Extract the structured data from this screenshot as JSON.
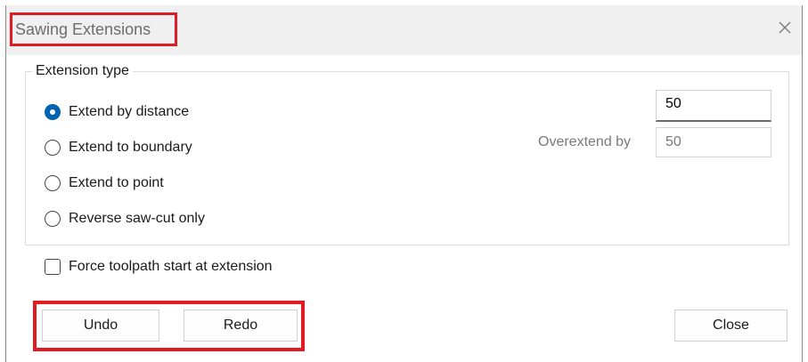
{
  "window": {
    "title": "Sawing Extensions"
  },
  "group": {
    "label": "Extension type",
    "options": [
      {
        "label": "Extend by distance",
        "checked": true
      },
      {
        "label": "Extend to boundary",
        "checked": false
      },
      {
        "label": "Extend to point",
        "checked": false
      },
      {
        "label": "Reverse saw-cut only",
        "checked": false
      }
    ],
    "distance_value": "50",
    "overextend_label": "Overextend by",
    "overextend_value": "50"
  },
  "checkbox": {
    "label": "Force toolpath start at extension",
    "checked": false
  },
  "buttons": {
    "undo": "Undo",
    "redo": "Redo",
    "close": "Close"
  },
  "colors": {
    "accent": "#0063b1",
    "highlight": "#e01b24"
  },
  "icons": {
    "close": "close-icon"
  }
}
